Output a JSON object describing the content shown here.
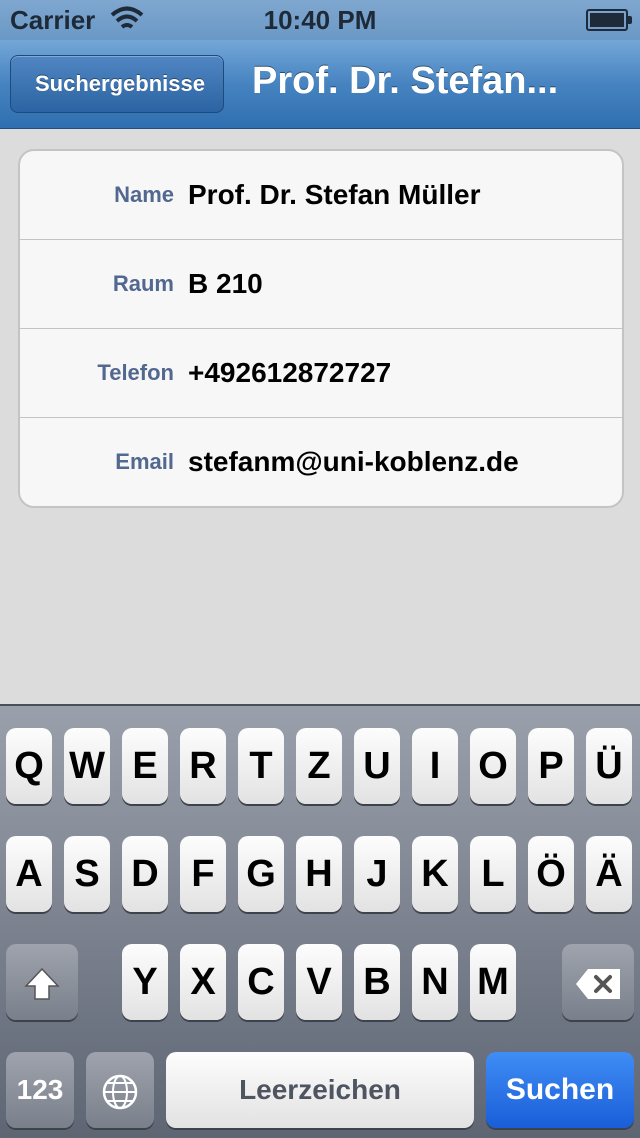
{
  "status_bar": {
    "carrier": "Carrier",
    "time": "10:40 PM"
  },
  "nav": {
    "back_label": "Suchergebnisse",
    "title": "Prof. Dr. Stefan..."
  },
  "details": [
    {
      "label": "Name",
      "value": "Prof. Dr. Stefan Müller"
    },
    {
      "label": "Raum",
      "value": "B 210"
    },
    {
      "label": "Telefon",
      "value": "+492612872727"
    },
    {
      "label": "Email",
      "value": "stefanm@uni-koblenz.de"
    }
  ],
  "keyboard": {
    "row1": [
      "Q",
      "W",
      "E",
      "R",
      "T",
      "Z",
      "U",
      "I",
      "O",
      "P",
      "Ü"
    ],
    "row2": [
      "A",
      "S",
      "D",
      "F",
      "G",
      "H",
      "J",
      "K",
      "L",
      "Ö",
      "Ä"
    ],
    "row3": [
      "Y",
      "X",
      "C",
      "V",
      "B",
      "N",
      "M"
    ],
    "numbers_label": "123",
    "space_label": "Leerzeichen",
    "search_label": "Suchen",
    "shift_icon": "shift-icon",
    "delete_icon": "backspace-icon",
    "globe_icon": "globe-icon"
  }
}
